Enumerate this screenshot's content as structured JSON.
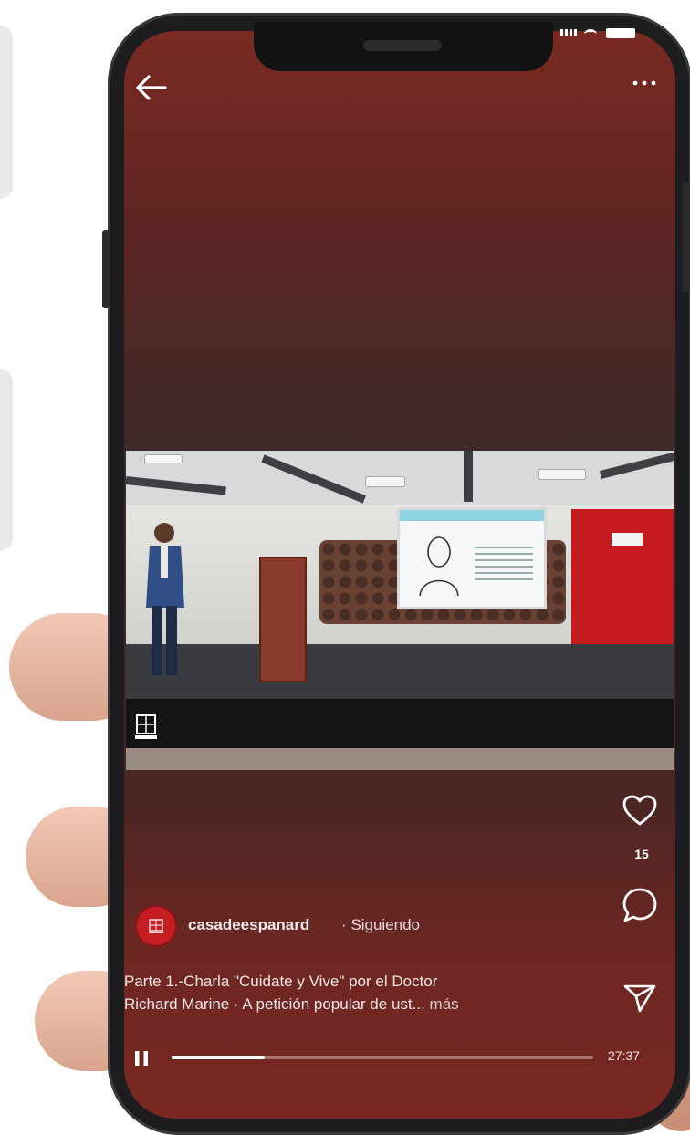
{
  "header": {
    "back_icon": "arrow-left-icon",
    "menu_icon": "more-horizontal-icon"
  },
  "post": {
    "username": "casadeespanard",
    "follow_status": "· Siguiendo",
    "caption_line1": "Parte 1.-Charla \"Cuidate y Vive\" por el Doctor",
    "caption_line2": "Richard Marine · A petición popular de ust...",
    "caption_more": "más"
  },
  "actions": {
    "like_icon": "heart-icon",
    "like_count": "15",
    "comment_icon": "comment-icon",
    "share_icon": "send-icon"
  },
  "player": {
    "pause_icon": "pause-icon",
    "duration": "27:37",
    "progress": 0.22
  },
  "colors": {
    "screen_bg": "#5e2624",
    "banner_red": "#c41a20",
    "accent_white": "#ffffff"
  }
}
